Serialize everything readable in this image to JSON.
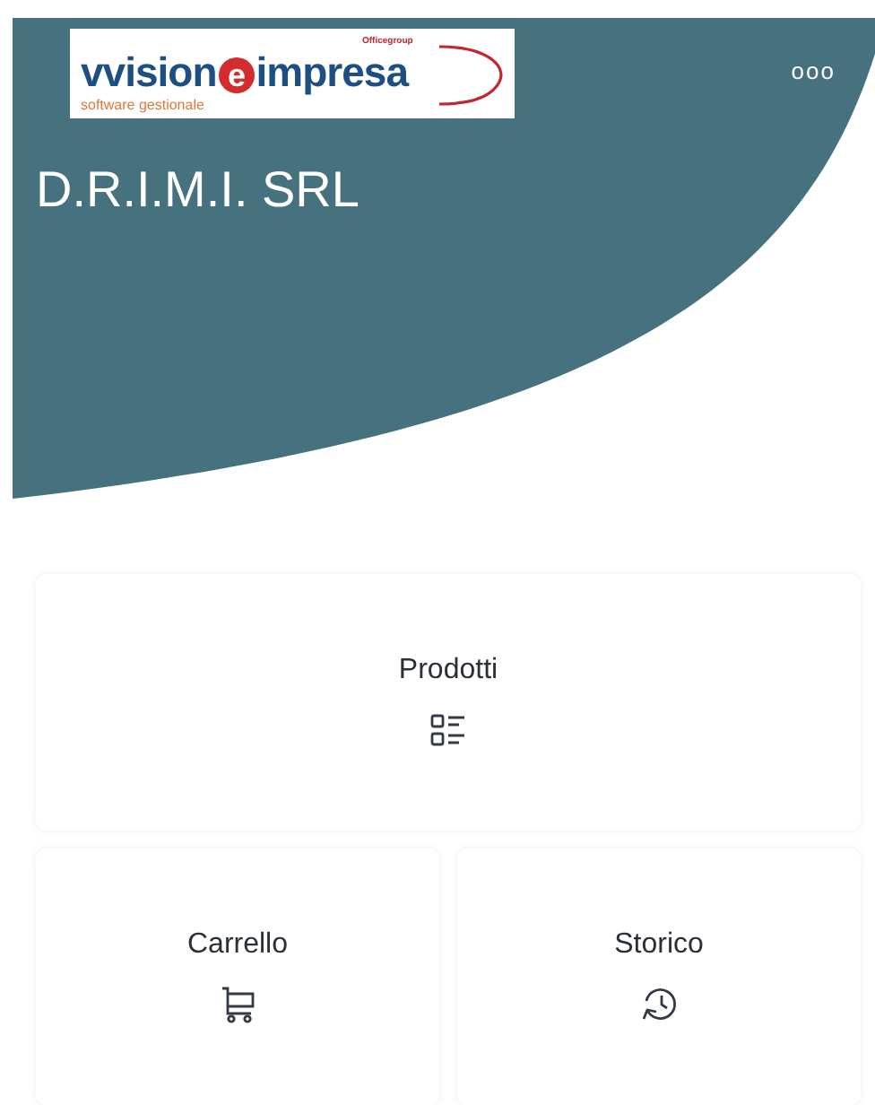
{
  "logo": {
    "wordmark_parts": [
      "vvision",
      "e",
      "impresa"
    ],
    "tagline": "software gestionale",
    "group": "Officegroup"
  },
  "menu_icon": "ooo",
  "company": "D.R.I.M.I. SRL",
  "tiles": [
    {
      "label": "Prodotti",
      "kind": "list"
    },
    {
      "label": "Carrello",
      "kind": "cart"
    },
    {
      "label": "Storico",
      "kind": "history"
    }
  ]
}
